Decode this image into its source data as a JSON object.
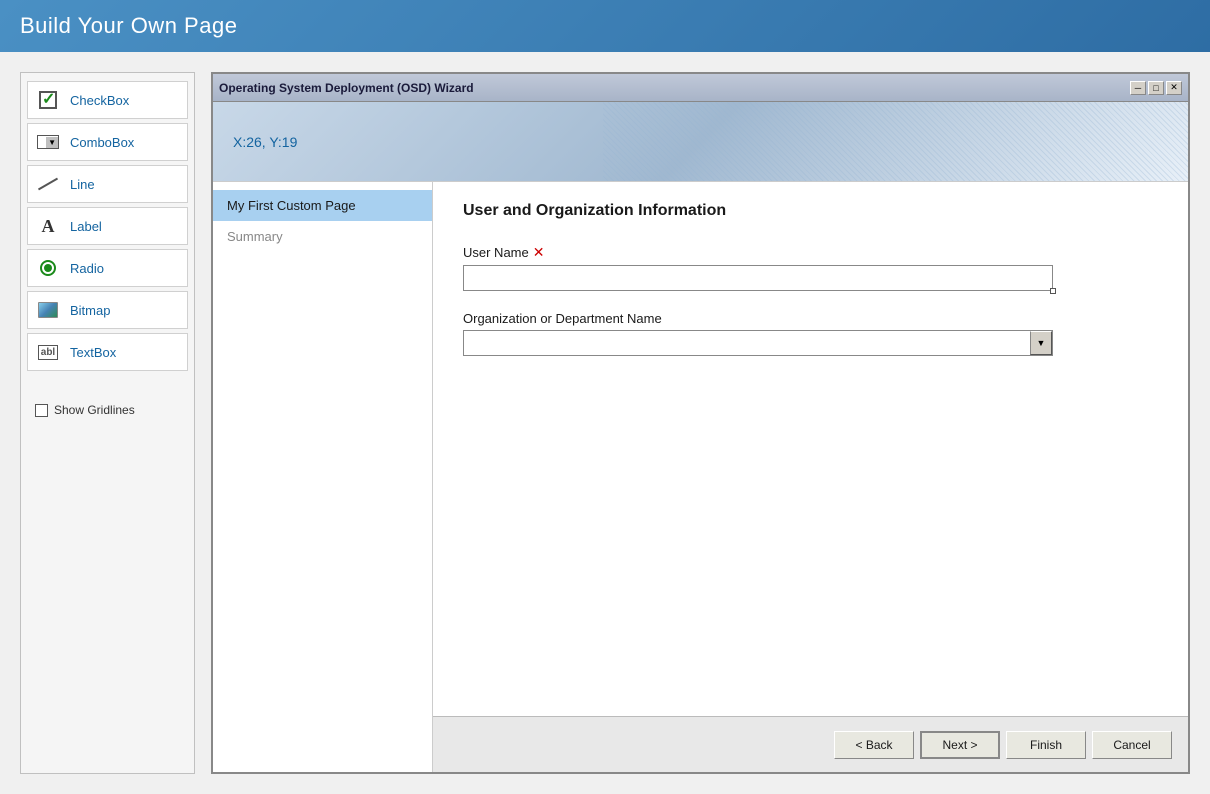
{
  "banner": {
    "title": "Build Your Own Page"
  },
  "toolbox": {
    "items": [
      {
        "id": "checkbox",
        "label": "CheckBox",
        "icon": "checkbox-icon"
      },
      {
        "id": "combobox",
        "label": "ComboBox",
        "icon": "combobox-icon"
      },
      {
        "id": "line",
        "label": "Line",
        "icon": "line-icon"
      },
      {
        "id": "label",
        "label": "Label",
        "icon": "label-icon"
      },
      {
        "id": "radio",
        "label": "Radio",
        "icon": "radio-icon"
      },
      {
        "id": "bitmap",
        "label": "Bitmap",
        "icon": "bitmap-icon"
      },
      {
        "id": "textbox",
        "label": "TextBox",
        "icon": "textbox-icon"
      }
    ],
    "show_gridlines_label": "Show Gridlines"
  },
  "wizard": {
    "title": "Operating System Deployment (OSD) Wizard",
    "controls": {
      "minimize": "─",
      "maximize": "□",
      "close": "✕"
    },
    "coordinates": "X:26, Y:19",
    "nav": [
      {
        "id": "custom-page",
        "label": "My First Custom Page",
        "active": true
      },
      {
        "id": "summary",
        "label": "Summary",
        "active": false
      }
    ],
    "section_title": "User and Organization Information",
    "fields": [
      {
        "id": "user-name",
        "label": "User Name",
        "required": true,
        "type": "text",
        "value": ""
      },
      {
        "id": "org-name",
        "label": "Organization or Department Name",
        "required": false,
        "type": "combobox",
        "value": ""
      }
    ],
    "buttons": [
      {
        "id": "back",
        "label": "< Back",
        "enabled": true
      },
      {
        "id": "next",
        "label": "Next >",
        "enabled": true,
        "primary": true
      },
      {
        "id": "finish",
        "label": "Finish",
        "enabled": false
      },
      {
        "id": "cancel",
        "label": "Cancel",
        "enabled": true
      }
    ]
  }
}
